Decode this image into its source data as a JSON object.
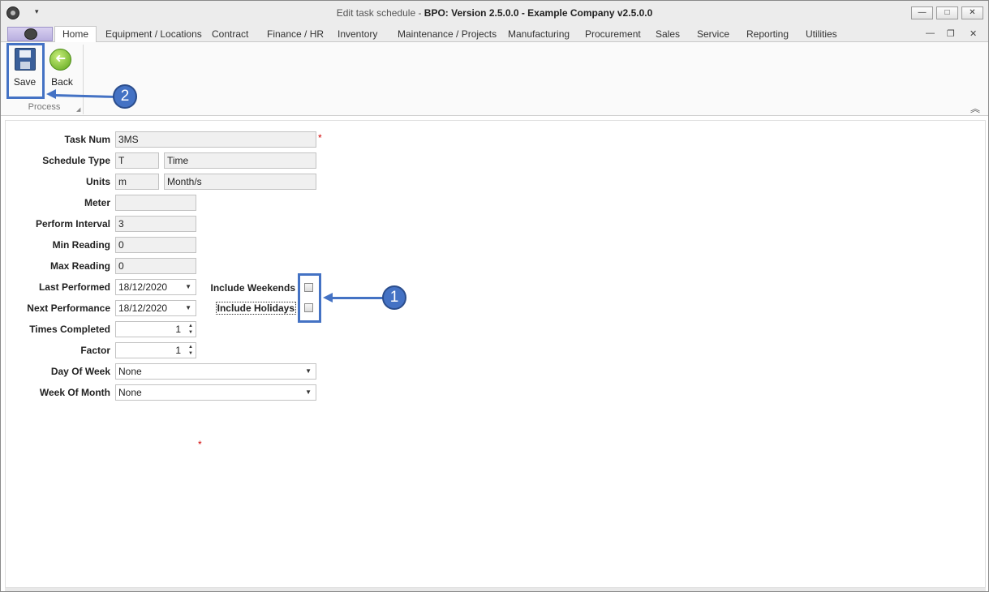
{
  "window": {
    "title_prefix": "Edit task schedule - ",
    "title_bold": "BPO: Version 2.5.0.0 - Example Company v2.5.0.0",
    "minimize_glyph": "—",
    "maximize_glyph": "□",
    "close_glyph": "✕",
    "qa_dropdown": "▾"
  },
  "tabs": [
    {
      "label": "Home"
    },
    {
      "label": "Equipment / Locations"
    },
    {
      "label": "Contract"
    },
    {
      "label": "Finance / HR"
    },
    {
      "label": "Inventory"
    },
    {
      "label": "Maintenance / Projects"
    },
    {
      "label": "Manufacturing"
    },
    {
      "label": "Procurement"
    },
    {
      "label": "Sales"
    },
    {
      "label": "Service"
    },
    {
      "label": "Reporting"
    },
    {
      "label": "Utilities"
    }
  ],
  "mdi": {
    "minimize": "—",
    "restore": "❐",
    "close": "✕"
  },
  "ribbon": {
    "save_label": "Save",
    "back_label": "Back",
    "back_glyph": "➜",
    "group_label": "Process",
    "launcher_glyph": "◢",
    "collapse_glyph": "︽"
  },
  "annotations": {
    "badge1": "1",
    "badge2": "2"
  },
  "form": {
    "task_num": {
      "label": "Task Num",
      "value": "3MS",
      "required": "*"
    },
    "schedule_type": {
      "label": "Schedule Type",
      "code": "T",
      "desc": "Time"
    },
    "units": {
      "label": "Units",
      "code": "m",
      "desc": "Month/s"
    },
    "meter": {
      "label": "Meter",
      "value": ""
    },
    "perform_interval": {
      "label": "Perform Interval",
      "value": "3"
    },
    "min_reading": {
      "label": "Min Reading",
      "value": "0"
    },
    "max_reading": {
      "label": "Max Reading",
      "value": "0"
    },
    "last_performed": {
      "label": "Last Performed",
      "value": "18/12/2020"
    },
    "next_performance": {
      "label": "Next Performance",
      "value": "18/12/2020"
    },
    "times_completed": {
      "label": "Times Completed",
      "value": "1"
    },
    "factor": {
      "label": "Factor",
      "value": "1"
    },
    "day_of_week": {
      "label": "Day Of Week",
      "value": "None"
    },
    "week_of_month": {
      "label": "Week Of Month",
      "value": "None"
    },
    "include_weekends": {
      "label": "Include Weekends",
      "checked": false
    },
    "include_holidays": {
      "label": "Include Holidays",
      "checked": false
    },
    "footer_required": "*",
    "dropdown_glyph": "▼",
    "spin_up": "▲",
    "spin_down": "▼"
  }
}
